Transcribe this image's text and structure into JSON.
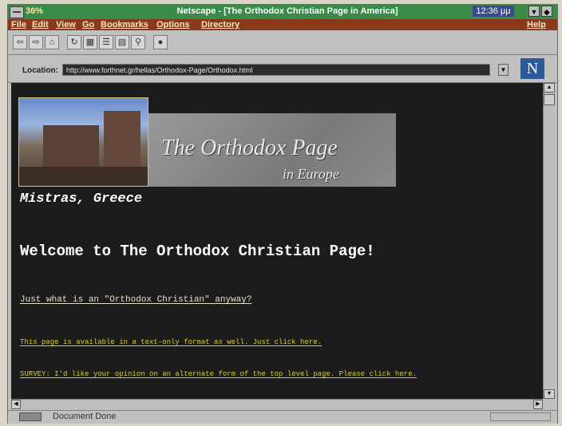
{
  "window": {
    "zoom_percent": "36%",
    "title": "Netscape - [The Orthodox Christian Page in America]",
    "clock": "12:36 μμ"
  },
  "menu": {
    "items": [
      "File",
      "Edit",
      "View",
      "Go",
      "Bookmarks",
      "Options",
      "Directory"
    ],
    "help": "Help"
  },
  "toolbar": {
    "buttons": [
      "back-icon",
      "forward-icon",
      "home-icon",
      "reload-icon",
      "images-icon",
      "open-icon",
      "print-icon",
      "find-icon",
      "stop-icon"
    ]
  },
  "location": {
    "label": "Location:",
    "url": "http://www.forthnet.gr/hellas/Orthodox-Page/Orthodox.html"
  },
  "page": {
    "banner_title": "The Orthodox Page",
    "banner_subtitle": "in Europe",
    "caption": "Mistras, Greece",
    "heading": "Welcome to The Orthodox Christian Page!",
    "link_question": "Just what is an \"Orthodox Christian\" anyway?",
    "link_text_only": "This page is available in a text-only format as well. Just click here.",
    "link_survey": "SURVEY: I'd like your opinion on an alternate form of the top level page. Please click here."
  },
  "status": {
    "text": "Document Done"
  }
}
